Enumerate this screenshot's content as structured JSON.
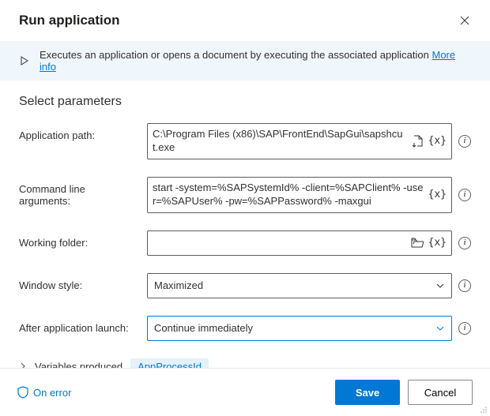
{
  "header": {
    "title": "Run application"
  },
  "info": {
    "text": "Executes an application or opens a document by executing the associated application ",
    "link": "More info"
  },
  "section": {
    "title": "Select parameters"
  },
  "labels": {
    "appPath": "Application path:",
    "cmdArgs": "Command line arguments:",
    "workFolder": "Working folder:",
    "windowStyle": "Window style:",
    "afterLaunch": "After application launch:"
  },
  "values": {
    "appPath": "C:\\Program Files (x86)\\SAP\\FrontEnd\\SapGui\\sapshcut.exe",
    "cmdArgs": "start -system=%SAPSystemId% -client=%SAPClient% -user=%SAPUser% -pw=%SAPPassword% -maxgui",
    "workFolder": "",
    "windowStyle": "Maximized",
    "afterLaunch": "Continue immediately"
  },
  "tokens": {
    "variable": "{x}"
  },
  "variablesProduced": {
    "label": "Variables produced",
    "badge": "AppProcessId"
  },
  "footer": {
    "onError": "On error",
    "save": "Save",
    "cancel": "Cancel"
  }
}
